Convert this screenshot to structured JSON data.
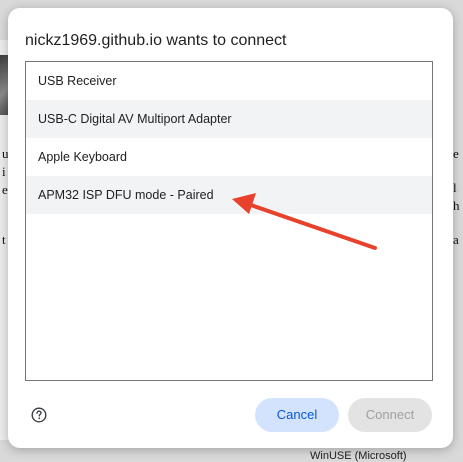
{
  "dialog": {
    "title": "nickz1969.github.io wants to connect",
    "devices": [
      {
        "label": "USB Receiver"
      },
      {
        "label": "USB-C Digital AV Multiport Adapter"
      },
      {
        "label": "Apple Keyboard"
      },
      {
        "label": "APM32 ISP DFU mode - Paired"
      }
    ],
    "cancel_label": "Cancel",
    "connect_label": "Connect",
    "help_icon": "help-circle-icon"
  },
  "background": {
    "bottom_text": "WinUSE (Microsoft)"
  },
  "annotation": {
    "arrow_color": "#e8412c",
    "points_to": "APM32 ISP DFU mode - Paired"
  }
}
